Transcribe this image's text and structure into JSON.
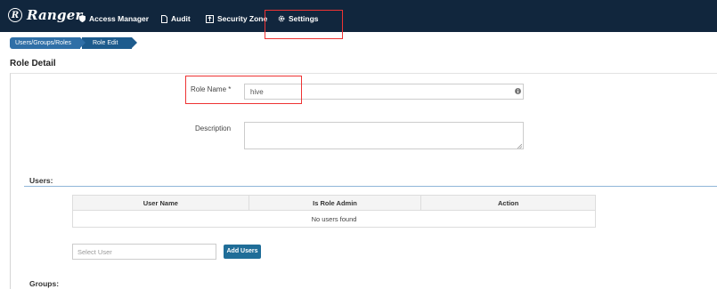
{
  "navbar": {
    "brand": "Ranger",
    "brand_logo": "R",
    "items": [
      {
        "label": "Access Manager",
        "icon": "shield-icon"
      },
      {
        "label": "Audit",
        "icon": "file-icon"
      },
      {
        "label": "Security Zone",
        "icon": "zone-icon"
      },
      {
        "label": "Settings",
        "icon": "gear-icon"
      }
    ]
  },
  "breadcrumb": [
    "Users/Groups/Roles",
    "Role Edit"
  ],
  "page": {
    "title": "Role Detail"
  },
  "form": {
    "role_name_label": "Role Name *",
    "role_name_value": "hive",
    "description_label": "Description",
    "description_value": ""
  },
  "users": {
    "section_label": "Users:",
    "columns": [
      "User Name",
      "Is Role Admin",
      "Action"
    ],
    "empty_text": "No users found",
    "select_placeholder": "Select User",
    "add_button": "Add Users"
  },
  "groups": {
    "section_label": "Groups:"
  },
  "colors": {
    "navbar_bg": "#11263d",
    "breadcrumb_bg": "#2f6fa7",
    "button_bg": "#1f6d98",
    "highlight": "#ee3333"
  }
}
